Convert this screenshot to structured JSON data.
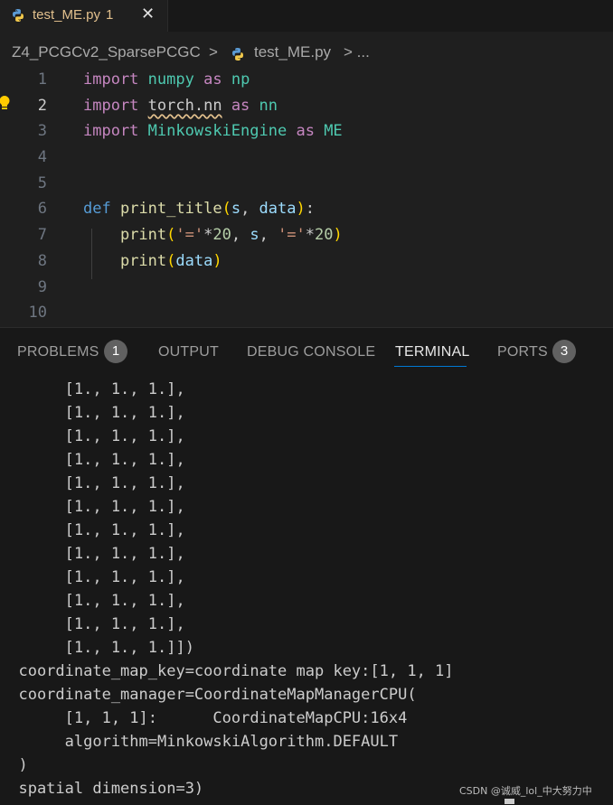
{
  "tab": {
    "title": "test_ME.py",
    "problem_count": "1",
    "close": "✕"
  },
  "breadcrumb": {
    "folder": "Z4_PCGCv2_SparsePCGC",
    "sep1": ">",
    "file": "test_ME.py",
    "sep2": "> ..."
  },
  "editor": {
    "line_numbers": [
      "1",
      "2",
      "3",
      "4",
      "5",
      "6",
      "7",
      "8",
      "9",
      "10"
    ],
    "active_line": "2",
    "code": {
      "l1": {
        "kw1": "import",
        "mod": "numpy",
        "kw2": "as",
        "alias": "np"
      },
      "l2": {
        "kw1": "import",
        "mod": "torch.nn",
        "kw2": "as",
        "alias": "nn"
      },
      "l3": {
        "kw1": "import",
        "mod": "MinkowskiEngine",
        "kw2": "as",
        "alias": "ME"
      },
      "l6": {
        "def": "def",
        "name": "print_title",
        "open": "(",
        "p1": "s",
        "comma": ", ",
        "p2": "data",
        "close": ")",
        "colon": ":"
      },
      "l7": {
        "fn": "print",
        "open": "(",
        "s1": "'='",
        "op1": "*",
        "n1": "20",
        "c1": ", ",
        "v": "s",
        "c2": ", ",
        "s2": "'='",
        "op2": "*",
        "n2": "20",
        "close": ")"
      },
      "l8": {
        "fn": "print",
        "open": "(",
        "v": "data",
        "close": ")"
      }
    }
  },
  "panel": {
    "tabs": [
      "PROBLEMS",
      "OUTPUT",
      "DEBUG CONSOLE",
      "TERMINAL",
      "PORTS"
    ],
    "active_tab": "TERMINAL",
    "problems_badge": "1",
    "ports_badge": "3"
  },
  "terminal": {
    "lines": [
      "       [1., 1., 1.],",
      "       [1., 1., 1.],",
      "       [1., 1., 1.],",
      "       [1., 1., 1.],",
      "       [1., 1., 1.],",
      "       [1., 1., 1.],",
      "       [1., 1., 1.],",
      "       [1., 1., 1.],",
      "       [1., 1., 1.],",
      "       [1., 1., 1.],",
      "       [1., 1., 1.],",
      "       [1., 1., 1.]])",
      "  coordinate_map_key=coordinate map key:[1, 1, 1]",
      "  coordinate_manager=CoordinateMapManagerCPU(",
      "       [1, 1, 1]:      CoordinateMapCPU:16x4",
      "       algorithm=MinkowskiAlgorithm.DEFAULT",
      "  )",
      "  spatial dimension=3)"
    ]
  },
  "watermark": "CSDN @诚威_lol_中大努力中",
  "colors": {
    "editor_bg": "#1f1f1f",
    "panel_bg": "#181818",
    "accent": "#0078d4",
    "keyword": "#c586c0",
    "module": "#4ec9b0",
    "function": "#dcdcaa",
    "string": "#ce9178"
  }
}
